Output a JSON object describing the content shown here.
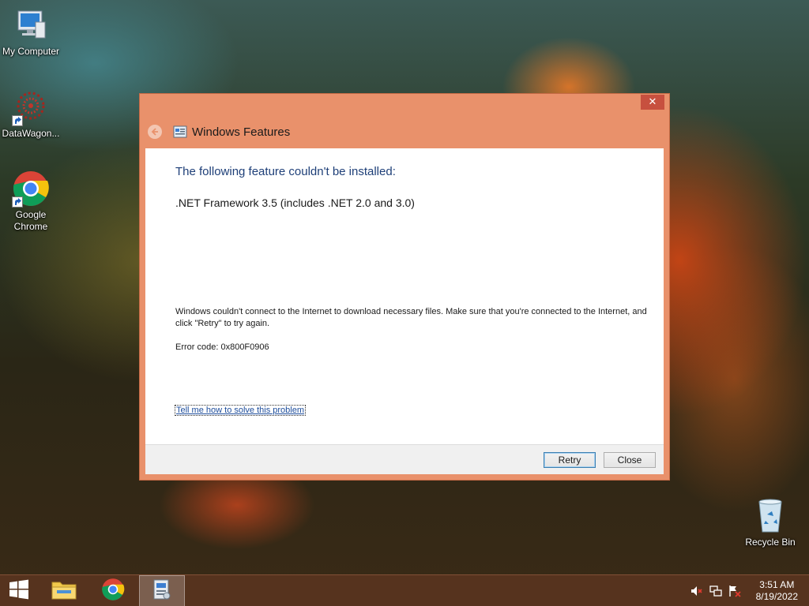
{
  "desktop": {
    "icons": [
      {
        "label": "My Computer",
        "icon": "my-computer-icon"
      },
      {
        "label": "DataWagon...",
        "icon": "datawagon-icon"
      },
      {
        "label": "Google Chrome",
        "icon": "chrome-icon"
      },
      {
        "label": "Recycle Bin",
        "icon": "recycle-bin-icon"
      }
    ]
  },
  "dialog": {
    "title": "Windows Features",
    "close_glyph": "✕",
    "heading": "The following feature couldn't be installed:",
    "feature": ".NET Framework 3.5 (includes .NET 2.0 and 3.0)",
    "message": "Windows couldn't connect to the Internet to download necessary files. Make sure that you're connected to the Internet, and click \"Retry\" to try again.",
    "error_code": "Error code: 0x800F0906",
    "help_link": "Tell me how to solve this problem",
    "buttons": {
      "retry": "Retry",
      "close": "Close"
    },
    "colors": {
      "frame": "#e9916b",
      "heading": "#1e3f78",
      "link": "#1d4d9c",
      "close_button": "#c7503f"
    }
  },
  "taskbar": {
    "pinned": [
      "windows-start-icon",
      "file-explorer-icon",
      "chrome-icon",
      "windows-features-icon"
    ],
    "tray": [
      "volume-muted-icon",
      "network-icon",
      "action-center-flag-icon"
    ],
    "clock": {
      "time": "3:51 AM",
      "date": "8/19/2022"
    }
  }
}
